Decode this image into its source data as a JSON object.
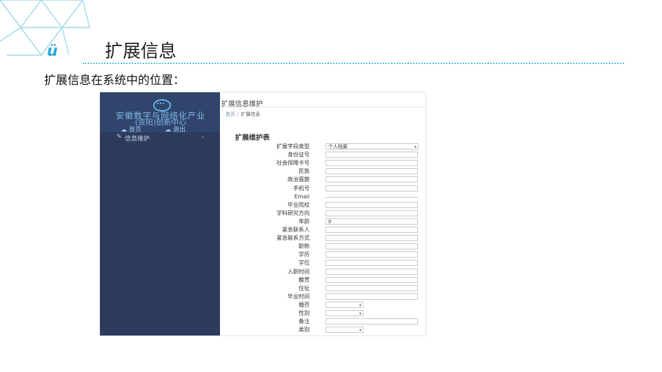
{
  "slide": {
    "logo_text": "ü",
    "title": "扩展信息",
    "subtitle": "扩展信息在系统中的位置："
  },
  "screenshot": {
    "sidebar": {
      "org_line1": "安徽数字与网络化产业",
      "org_line2": "(资阳)创新中心",
      "home_label": "首页",
      "logout_label": "退出",
      "menu_item_label": "信息维护",
      "menu_chevron": "⌄"
    },
    "header": {
      "title": "扩展信息维护",
      "breadcrumb": [
        {
          "label": "首页"
        },
        {
          "label": "扩展信息"
        }
      ]
    },
    "form": {
      "section_title": "扩展维护表",
      "rows": [
        {
          "label": "扩展字段类型",
          "value": "个人档案",
          "kind": "select"
        },
        {
          "label": "身份证号",
          "value": "",
          "kind": "text"
        },
        {
          "label": "社会保障卡号",
          "value": "",
          "kind": "text"
        },
        {
          "label": "民族",
          "value": "",
          "kind": "text"
        },
        {
          "label": "政治面貌",
          "value": "",
          "kind": "text"
        },
        {
          "label": "手机号",
          "value": "",
          "kind": "text"
        },
        {
          "label": "Email",
          "value": "",
          "kind": "line"
        },
        {
          "label": "毕业院校",
          "value": "",
          "kind": "text"
        },
        {
          "label": "学科研究方向",
          "value": "",
          "kind": "text"
        },
        {
          "label": "年龄",
          "value": "0",
          "kind": "text"
        },
        {
          "label": "紧急联系人",
          "value": "",
          "kind": "text"
        },
        {
          "label": "紧急联系方式",
          "value": "",
          "kind": "text"
        },
        {
          "label": "职称",
          "value": "",
          "kind": "text"
        },
        {
          "label": "学历",
          "value": "",
          "kind": "text"
        },
        {
          "label": "学位",
          "value": "",
          "kind": "text"
        },
        {
          "label": "入职时间",
          "value": "",
          "kind": "text"
        },
        {
          "label": "籍贯",
          "value": "",
          "kind": "text"
        },
        {
          "label": "住址",
          "value": "",
          "kind": "text"
        },
        {
          "label": "毕业时间",
          "value": "",
          "kind": "text"
        },
        {
          "label": "婚否",
          "value": "",
          "kind": "small-select"
        },
        {
          "label": "性别",
          "value": "",
          "kind": "small-select"
        },
        {
          "label": "备注",
          "value": "",
          "kind": "text"
        },
        {
          "label": "类别",
          "value": "",
          "kind": "small-select"
        }
      ]
    }
  },
  "colors": {
    "accent": "#4ec3de",
    "sidebar_bg": "#2c3a5c",
    "sidebar_text": "#7cb7e6"
  }
}
